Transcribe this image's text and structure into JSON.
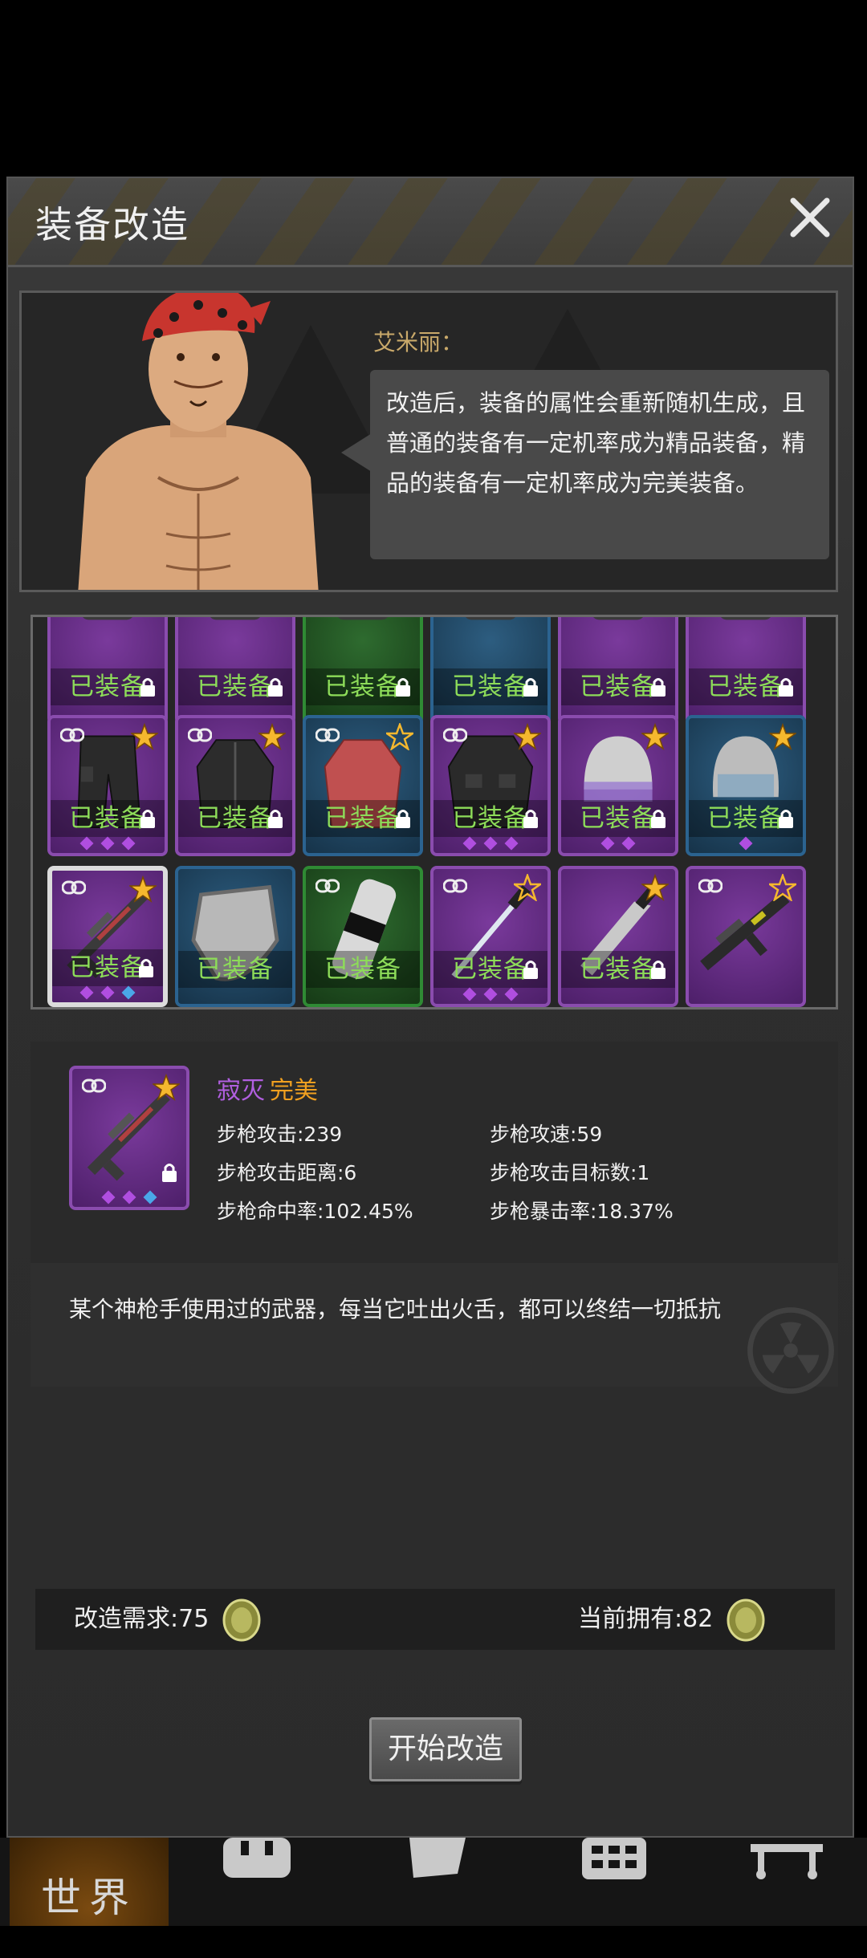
{
  "window": {
    "title": "装备改造"
  },
  "npc": {
    "name": "艾米丽：",
    "speech": "改造后，装备的属性会重新随机生成，且普通的装备有一定机率成为精品装备，精品的装备有一定机率成为完美装备。"
  },
  "inventory": {
    "equipped_label": "已装备",
    "rows": [
      {
        "items": [
          {
            "icon": "gear-partial",
            "rarity": "purple",
            "equipped": true,
            "locked": true
          },
          {
            "icon": "gear-partial",
            "rarity": "purple",
            "equipped": true,
            "locked": true
          },
          {
            "icon": "gear-partial",
            "rarity": "green",
            "equipped": true,
            "locked": true
          },
          {
            "icon": "gear-partial",
            "rarity": "blue",
            "equipped": true,
            "locked": true
          },
          {
            "icon": "gear-partial",
            "rarity": "purple",
            "equipped": true,
            "locked": true
          },
          {
            "icon": "gear-partial",
            "rarity": "purple",
            "equipped": true,
            "locked": true
          }
        ]
      },
      {
        "items": [
          {
            "icon": "cargo-pants-icon",
            "rarity": "purple",
            "equipped": true,
            "locked": true,
            "star": "gold",
            "link": true,
            "gems": [
              "purple",
              "purple",
              "purple"
            ]
          },
          {
            "icon": "jacket-icon",
            "rarity": "purple",
            "equipped": true,
            "locked": true,
            "star": "gold",
            "link": true,
            "gems": []
          },
          {
            "icon": "shirt-icon",
            "rarity": "blue",
            "equipped": true,
            "locked": true,
            "star": "outline",
            "link": true,
            "gems": []
          },
          {
            "icon": "tactical-jacket-icon",
            "rarity": "purple",
            "equipped": true,
            "locked": true,
            "star": "gold",
            "link": true,
            "gems": [
              "purple",
              "purple",
              "purple"
            ]
          },
          {
            "icon": "police-helmet-icon",
            "rarity": "purple",
            "equipped": true,
            "locked": true,
            "star": "gold",
            "link": false,
            "gems": [
              "purple",
              "purple"
            ]
          },
          {
            "icon": "helmet-icon",
            "rarity": "blue",
            "equipped": true,
            "locked": true,
            "star": "gold",
            "link": false,
            "gems": [
              "purple"
            ]
          }
        ]
      },
      {
        "items": [
          {
            "icon": "sniper-rifle-icon",
            "rarity": "purple",
            "equipped": true,
            "locked": true,
            "star": "gold",
            "link": true,
            "selected": true,
            "gems": [
              "purple",
              "purple",
              "blue"
            ]
          },
          {
            "icon": "shield-icon",
            "rarity": "blue",
            "equipped": true,
            "locked": false,
            "star": "none",
            "link": false,
            "gems": []
          },
          {
            "icon": "arm-guard-icon",
            "rarity": "green",
            "equipped": true,
            "locked": false,
            "star": "none",
            "link": true,
            "gems": []
          },
          {
            "icon": "katana-icon",
            "rarity": "purple",
            "equipped": true,
            "locked": true,
            "star": "outline",
            "link": true,
            "gems": [
              "purple",
              "purple",
              "purple"
            ]
          },
          {
            "icon": "machete-icon",
            "rarity": "purple",
            "equipped": true,
            "locked": true,
            "star": "gold",
            "link": false,
            "gems": []
          },
          {
            "icon": "assault-rifle-icon",
            "rarity": "purple",
            "equipped": false,
            "locked": false,
            "star": "outline",
            "link": true,
            "gems": []
          }
        ]
      }
    ]
  },
  "detail": {
    "name": "寂灭",
    "quality": "完美",
    "stats": [
      {
        "label": "步枪攻击:239"
      },
      {
        "label": "步枪攻速:59"
      },
      {
        "label": "步枪攻击距离:6"
      },
      {
        "label": "步枪攻击目标数:1"
      },
      {
        "label": "步枪命中率:102.45%"
      },
      {
        "label": "步枪暴击率:18.37%"
      }
    ],
    "description": "某个神枪手使用过的武器，每当它吐出火舌，都可以终结一切抵抗",
    "gems": [
      "purple",
      "purple",
      "blue"
    ]
  },
  "cost": {
    "required": "改造需求:75",
    "owned": "当前拥有:82"
  },
  "start_button": "开始改造",
  "nav": {
    "world": "世界"
  },
  "colors": {
    "rarity_purple": "#7a3a9c",
    "rarity_blue": "#2d5d80",
    "rarity_green": "#2e6b2f",
    "equipped_text": "#8ddc59",
    "quality_perfect": "#f0a020",
    "item_name": "#b15fe0"
  }
}
